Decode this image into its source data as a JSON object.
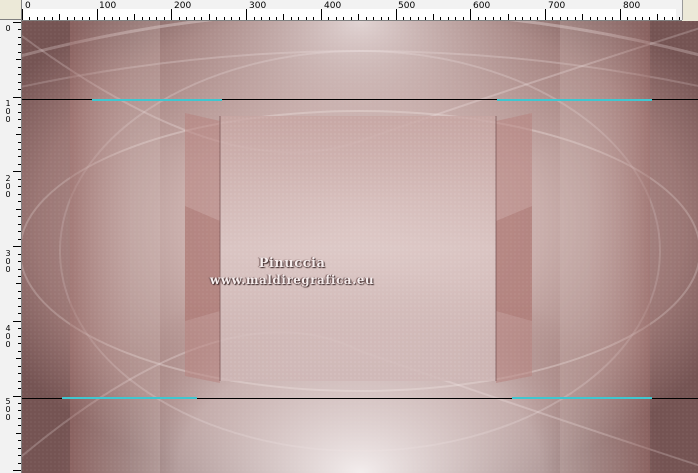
{
  "ruler_top": {
    "labels": [
      "0",
      "100",
      "200",
      "300",
      "400",
      "500",
      "600",
      "700",
      "800"
    ]
  },
  "ruler_left": {
    "labels": [
      "0",
      "100",
      "200",
      "300",
      "400",
      "500"
    ]
  },
  "canvas": {
    "watermark": {
      "line1": "Pinuccia",
      "line2": "www.maldiregrafica.eu"
    }
  },
  "colors": {
    "base": "#b28d88",
    "dark": "#7a5654",
    "light": "#e8dada",
    "guide": "#000000",
    "guide_accent": "#3fc7d0"
  }
}
